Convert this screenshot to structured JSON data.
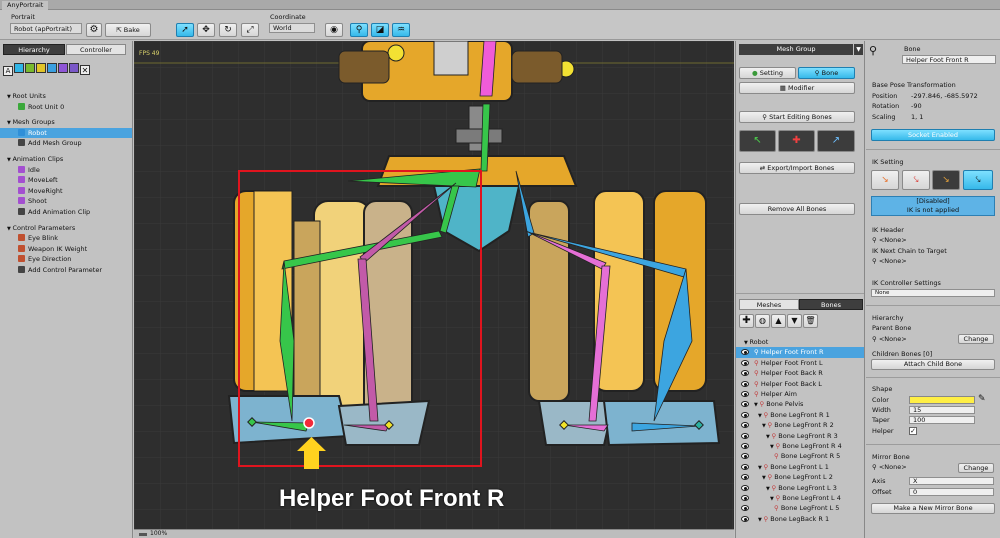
{
  "app": {
    "title": "AnyPortrait"
  },
  "toolbar": {
    "portrait_label": "Portrait",
    "portrait_value": "Robot (apPortrait)",
    "bake_label": "Bake",
    "coordinate_label": "Coordinate",
    "coordinate_value": "World"
  },
  "left": {
    "tabs": [
      "Hierarchy",
      "Controller"
    ],
    "items": [
      {
        "text": "Root Units",
        "kind": "header"
      },
      {
        "text": "Root Unit 0",
        "kind": "item"
      },
      {
        "text": "Mesh Groups",
        "kind": "header"
      },
      {
        "text": "Robot",
        "kind": "item",
        "selected": true
      },
      {
        "text": "Add Mesh Group",
        "kind": "item"
      },
      {
        "text": "Animation Clips",
        "kind": "header"
      },
      {
        "text": "Idle",
        "kind": "item"
      },
      {
        "text": "MoveLeft",
        "kind": "item"
      },
      {
        "text": "MoveRight",
        "kind": "item"
      },
      {
        "text": "Shoot",
        "kind": "item"
      },
      {
        "text": "Add Animation Clip",
        "kind": "item"
      },
      {
        "text": "Control Parameters",
        "kind": "header"
      },
      {
        "text": "Eye Blink",
        "kind": "item"
      },
      {
        "text": "Weapon IK Weight",
        "kind": "item"
      },
      {
        "text": "Eye Direction",
        "kind": "item"
      },
      {
        "text": "Add Control Parameter",
        "kind": "item"
      }
    ]
  },
  "viewport": {
    "fps": "FPS 49",
    "zoom": "100%",
    "callout": "Helper Foot Front R"
  },
  "mid": {
    "title": "Mesh Group",
    "setting_tab": "Setting",
    "bone_tab": "Bone",
    "modifier": "Modifier",
    "start_editing": "Start Editing Bones",
    "export_import": "Export/Import Bones",
    "remove_all": "Remove All Bones",
    "list_tabs": [
      "Meshes",
      "Bones"
    ],
    "bones": [
      {
        "text": "Robot",
        "depth": 0,
        "eye": false,
        "arrow": "▼"
      },
      {
        "text": "Helper Foot Front R",
        "depth": 1,
        "eye": true,
        "selected": true
      },
      {
        "text": "Helper Foot Front L",
        "depth": 1,
        "eye": true
      },
      {
        "text": "Helper Foot Back R",
        "depth": 1,
        "eye": true
      },
      {
        "text": "Helper Foot Back L",
        "depth": 1,
        "eye": true
      },
      {
        "text": "Helper Aim",
        "depth": 1,
        "eye": true
      },
      {
        "text": "Bone Pelvis",
        "depth": 1,
        "eye": true,
        "arrow": "▼"
      },
      {
        "text": "Bone LegFront R 1",
        "depth": 2,
        "eye": true,
        "arrow": "▼"
      },
      {
        "text": "Bone LegFront R 2",
        "depth": 3,
        "eye": true,
        "arrow": "▼"
      },
      {
        "text": "Bone LegFront R 3",
        "depth": 4,
        "eye": true,
        "arrow": "▼"
      },
      {
        "text": "Bone LegFront R 4",
        "depth": 5,
        "eye": true,
        "arrow": "▼"
      },
      {
        "text": "Bone LegFront R 5",
        "depth": 6,
        "eye": true
      },
      {
        "text": "Bone LegFront L 1",
        "depth": 2,
        "eye": true,
        "arrow": "▼"
      },
      {
        "text": "Bone LegFront L 2",
        "depth": 3,
        "eye": true,
        "arrow": "▼"
      },
      {
        "text": "Bone LegFront L 3",
        "depth": 4,
        "eye": true,
        "arrow": "▼"
      },
      {
        "text": "Bone LegFront L 4",
        "depth": 5,
        "eye": true,
        "arrow": "▼"
      },
      {
        "text": "Bone LegFront L 5",
        "depth": 6,
        "eye": true
      },
      {
        "text": "Bone LegBack R 1",
        "depth": 2,
        "eye": true,
        "arrow": "▼"
      }
    ]
  },
  "right": {
    "bone_label": "Bone",
    "bone_name": "Helper Foot Front R",
    "base_pose": "Base Pose Transformation",
    "position_label": "Position",
    "position_value": "-297.846, -685.5972",
    "rotation_label": "Rotation",
    "rotation_value": "-90",
    "scaling_label": "Scaling",
    "scaling_value": "1, 1",
    "socket": "Socket Enabled",
    "ik_setting": "IK Setting",
    "ik_disabled": "[Disabled]",
    "ik_not_applied": "IK is not applied",
    "ik_header": "IK Header",
    "ik_header_value": "<None>",
    "ik_next": "IK Next Chain to Target",
    "ik_next_value": "<None>",
    "ik_ctrl": "IK Controller Settings",
    "ik_ctrl_value": "None",
    "hierarchy": "Hierarchy",
    "parent_bone": "Parent Bone",
    "parent_value": "<None>",
    "change": "Change",
    "children": "Children Bones [0]",
    "attach": "Attach Child Bone",
    "shape": "Shape",
    "color_label": "Color",
    "color_value": "#ffef45",
    "width_label": "Width",
    "width_value": "15",
    "taper_label": "Taper",
    "taper_value": "100",
    "helper_label": "Helper",
    "mirror": "Mirror Bone",
    "mirror_value": "<None>",
    "change2": "Change",
    "axis_label": "Axis",
    "axis_value": "X",
    "offset_label": "Offset",
    "offset_value": "0",
    "new_mirror": "Make a New Mirror Bone"
  }
}
